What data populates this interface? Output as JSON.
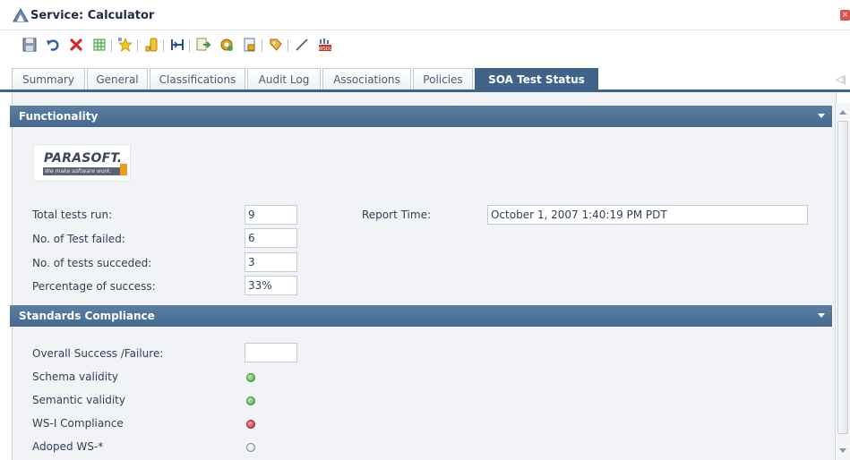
{
  "window": {
    "title": "Service: Calculator"
  },
  "toolbar": {
    "icons": [
      "save-icon",
      "undo-icon",
      "delete-icon",
      "grid-icon",
      "star-icon",
      "bucket-icon",
      "connect-icon",
      "export-icon",
      "gear-icon",
      "lock-icon",
      "tag-icon",
      "line-icon",
      "wsdl-icon"
    ]
  },
  "tabs": [
    {
      "label": "Summary"
    },
    {
      "label": "General"
    },
    {
      "label": "Classifications"
    },
    {
      "label": "Audit Log"
    },
    {
      "label": "Associations"
    },
    {
      "label": "Policies"
    },
    {
      "label": "SOA Test Status"
    }
  ],
  "functionality": {
    "title": "Functionality",
    "logo": {
      "brand": "PARASOFT.",
      "tagline": "We make software work."
    },
    "total_tests_label": "Total tests run:",
    "total_tests_value": "9",
    "failed_label": "No. of Test failed:",
    "failed_value": "6",
    "succeeded_label": "No. of tests succeded:",
    "succeeded_value": "3",
    "percentage_label": "Percentage of success:",
    "percentage_value": "33%",
    "report_time_label": "Report Time:",
    "report_time_value": "October 1, 2007 1:40:19 PM PDT"
  },
  "standards": {
    "title": "Standards Compliance",
    "overall_label": "Overall Success /Failure:",
    "overall_value": "",
    "schema_label": "Schema validity",
    "schema_status": "green",
    "semantic_label": "Semantic validity",
    "semantic_status": "green",
    "wsi_label": "WS-I Compliance",
    "wsi_status": "red",
    "adopted_label": "Adoped WS-*",
    "adopted_status": "empty"
  },
  "colors": {
    "header": "#4a6d92",
    "pass": "#3fa23a",
    "fail": "#c0282c"
  }
}
